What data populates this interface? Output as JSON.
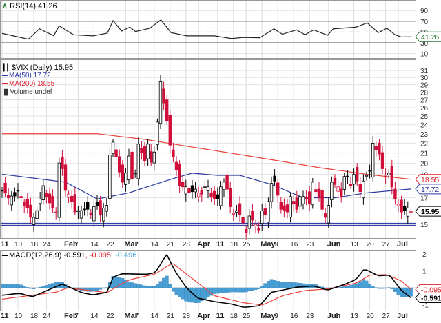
{
  "rsi": {
    "label": "RSI(14) 41.26",
    "last_box": "41.26",
    "ticks": [
      90,
      70,
      50,
      30,
      10
    ],
    "series": [
      [
        0,
        47.6
      ],
      [
        8.3,
        36.8
      ],
      [
        11.8,
        56
      ],
      [
        16.3,
        43.2
      ],
      [
        18,
        61.6
      ],
      [
        22.5,
        45
      ],
      [
        28.7,
        43
      ],
      [
        33.2,
        48
      ],
      [
        35,
        71
      ],
      [
        37.7,
        52
      ],
      [
        40.3,
        59
      ],
      [
        42.1,
        51
      ],
      [
        46.6,
        57
      ],
      [
        50.1,
        72.5
      ],
      [
        53.3,
        49
      ],
      [
        58.2,
        43
      ],
      [
        67,
        43
      ],
      [
        72.4,
        38
      ],
      [
        76,
        40
      ],
      [
        81.3,
        39.5
      ],
      [
        85.8,
        56
      ],
      [
        88.4,
        46
      ],
      [
        92.9,
        54
      ],
      [
        95.6,
        45
      ],
      [
        98.3,
        54
      ],
      [
        102.7,
        44
      ],
      [
        104.5,
        56
      ],
      [
        111.6,
        59
      ],
      [
        115.2,
        67
      ],
      [
        118.7,
        49
      ],
      [
        121.4,
        57
      ],
      [
        124,
        45
      ],
      [
        125.9,
        41
      ],
      [
        129,
        41.26
      ]
    ],
    "color": "#222222",
    "accent": "#2e7d32"
  },
  "price": {
    "title": "$VIX (Daily) 15.95",
    "ma50_label": "MA(50) 17.72",
    "ma200_label": "MA(200) 18.55",
    "volume_label": "Volume undef",
    "ticks": [
      31,
      30,
      29,
      28,
      27,
      26,
      25,
      24,
      23,
      22,
      21,
      20,
      19,
      17,
      15
    ],
    "boxes": [
      {
        "text": "18.55",
        "value": 18.55,
        "color": "#e0202a"
      },
      {
        "text": "17.72",
        "value": 17.72,
        "color": "#2a3aa0"
      },
      {
        "text": "15.95",
        "value": 15.95,
        "color": "#000000"
      }
    ],
    "support_level": 15,
    "close": [
      17.61,
      17.38,
      16.99,
      17.14,
      17.14,
      17.54,
      17.0,
      16.4,
      16.2,
      15.5,
      15.5,
      16.0,
      16.9,
      18.0,
      17.1,
      16.6,
      16.2,
      15.9,
      20.04,
      19.5,
      17.6,
      17.3,
      16.7,
      15.9,
      16.0,
      16.0,
      16.1,
      16.1,
      15.7,
      16.3,
      16.4,
      15.7,
      16.2,
      16.4,
      20.8,
      22.1,
      20.6,
      19.2,
      18.3,
      19.1,
      20.7,
      18.6,
      19.1,
      21.9,
      21.0,
      20.2,
      21.9,
      20.1,
      21.1,
      24.3,
      29.4,
      26.6,
      24.4,
      21.8,
      20.6,
      19.4,
      18.0,
      17.9,
      17.9,
      17.4,
      17.5,
      17.7,
      17.4,
      17.3,
      17.9,
      17.9,
      17.1,
      16.9,
      16.9,
      17.9,
      18.3,
      17.7,
      16.3,
      15.8,
      16.0,
      15.7,
      15.1,
      14.4,
      15.6,
      15.3,
      15.0,
      14.6,
      15.99,
      15.7,
      16.7,
      18.2,
      18.4,
      17.2,
      16.1,
      16.0,
      15.9,
      17.1,
      16.5,
      16.1,
      17.1,
      17.1,
      16.9,
      16.5,
      18.3,
      17.5,
      17.1,
      16.1,
      15.5,
      16.4,
      18.3,
      18.1,
      17.9,
      17.1,
      18.8,
      18.8,
      18.0,
      19.0,
      18.4,
      17.5,
      18.4,
      18.9,
      19.3,
      22.0,
      21.3,
      20.9,
      19.5,
      18.9,
      19.1,
      17.9,
      16.9,
      16.5,
      15.9,
      16.0,
      16.2,
      15.95
    ],
    "ma50": [
      [
        0,
        19.0
      ],
      [
        20,
        18.3
      ],
      [
        30,
        16.9
      ],
      [
        40,
        17.4
      ],
      [
        55,
        18.7
      ],
      [
        60,
        19.1
      ],
      [
        68,
        18.9
      ],
      [
        75,
        18.9
      ],
      [
        85,
        18.1
      ],
      [
        95,
        17.0
      ],
      [
        105,
        17.0
      ],
      [
        115,
        17.4
      ],
      [
        129,
        17.72
      ]
    ],
    "ma200": [
      [
        0,
        23.0
      ],
      [
        30,
        23.0
      ],
      [
        45,
        22.4
      ],
      [
        60,
        21.6
      ],
      [
        80,
        20.6
      ],
      [
        100,
        19.6
      ],
      [
        115,
        19.0
      ],
      [
        129,
        18.55
      ]
    ],
    "colors": {
      "up": "#000000",
      "down": "#d0103a",
      "ma50": "#2a3aa0",
      "ma200": "#e8413a",
      "support": "#3340a8"
    }
  },
  "dates": {
    "ticks": [
      [
        0,
        "11"
      ],
      [
        5,
        "10"
      ],
      [
        10,
        "18"
      ],
      [
        14,
        "24"
      ],
      [
        20,
        "Feb"
      ],
      [
        24,
        "7"
      ],
      [
        29,
        "14"
      ],
      [
        34,
        "22"
      ],
      [
        39,
        "Mar"
      ],
      [
        43,
        "7"
      ],
      [
        48,
        "14"
      ],
      [
        53,
        "21"
      ],
      [
        58,
        "28"
      ],
      [
        62,
        "Apr"
      ],
      [
        68,
        "11"
      ],
      [
        73,
        "18"
      ],
      [
        77,
        "25"
      ],
      [
        82,
        "May"
      ],
      [
        87,
        "9"
      ],
      [
        92,
        "16"
      ],
      [
        97,
        "23"
      ],
      [
        103,
        "Jun"
      ],
      [
        106,
        "6"
      ],
      [
        111,
        "13"
      ],
      [
        116,
        "20"
      ],
      [
        121,
        "27"
      ],
      [
        125,
        "Jul"
      ]
    ],
    "bold": [
      "11",
      "Feb",
      "Mar",
      "Apr",
      "May",
      "Jun",
      "Jul"
    ]
  },
  "macd": {
    "label_name": "MACD(12,26,9)",
    "label_macd": "-0.591",
    "label_signal": "-0.095",
    "label_hist": "-0.496",
    "ticks": [
      2,
      1,
      -1
    ],
    "boxes": [
      {
        "text": "-0.095",
        "value": -0.095,
        "color": "#e0202a"
      },
      {
        "text": "-0.591",
        "value": -0.591,
        "color": "#000000"
      }
    ],
    "line": [
      [
        0,
        -0.44
      ],
      [
        5.6,
        -0.33
      ],
      [
        9.6,
        -0.53
      ],
      [
        17.2,
        0.08
      ],
      [
        19,
        0.22
      ],
      [
        25.2,
        -0.29
      ],
      [
        28.7,
        -0.42
      ],
      [
        33.2,
        -0.26
      ],
      [
        35,
        0.62
      ],
      [
        37.7,
        0.83
      ],
      [
        45.7,
        0.8
      ],
      [
        48.4,
        0.9
      ],
      [
        51.9,
        1.99
      ],
      [
        54.6,
        0.97
      ],
      [
        58.2,
        0
      ],
      [
        61.7,
        -0.61
      ],
      [
        67,
        -0.82
      ],
      [
        72.4,
        -0.96
      ],
      [
        76.4,
        -1.16
      ],
      [
        81.3,
        -1.06
      ],
      [
        84.9,
        -0.27
      ],
      [
        88.4,
        -0.14
      ],
      [
        92.9,
        0.03
      ],
      [
        98.3,
        0.11
      ],
      [
        102.7,
        -0.14
      ],
      [
        108,
        0.2
      ],
      [
        111.6,
        0.48
      ],
      [
        114.3,
        1.12
      ],
      [
        118.7,
        0.71
      ],
      [
        122.3,
        0.75
      ],
      [
        125.9,
        -0.14
      ],
      [
        129,
        -0.591
      ]
    ],
    "signal": [
      [
        0,
        -0.67
      ],
      [
        17.2,
        -0.25
      ],
      [
        20.7,
        0
      ],
      [
        33.2,
        -0.29
      ],
      [
        36.8,
        0.15
      ],
      [
        40.3,
        0.48
      ],
      [
        48.4,
        0.82
      ],
      [
        53.7,
        1.46
      ],
      [
        60,
        0.55
      ],
      [
        67,
        -0.47
      ],
      [
        76,
        -0.88
      ],
      [
        82.2,
        -1.02
      ],
      [
        88.4,
        -0.47
      ],
      [
        95.6,
        -0.16
      ],
      [
        102.7,
        -0.07
      ],
      [
        111.6,
        0.27
      ],
      [
        116,
        0.75
      ],
      [
        121.4,
        0.78
      ],
      [
        125.9,
        0.41
      ],
      [
        129,
        -0.095
      ]
    ],
    "colors": {
      "line": "#000000",
      "signal": "#e8413a",
      "hist": "#4a9fd4",
      "hist_label": "#3aa0e0"
    }
  }
}
